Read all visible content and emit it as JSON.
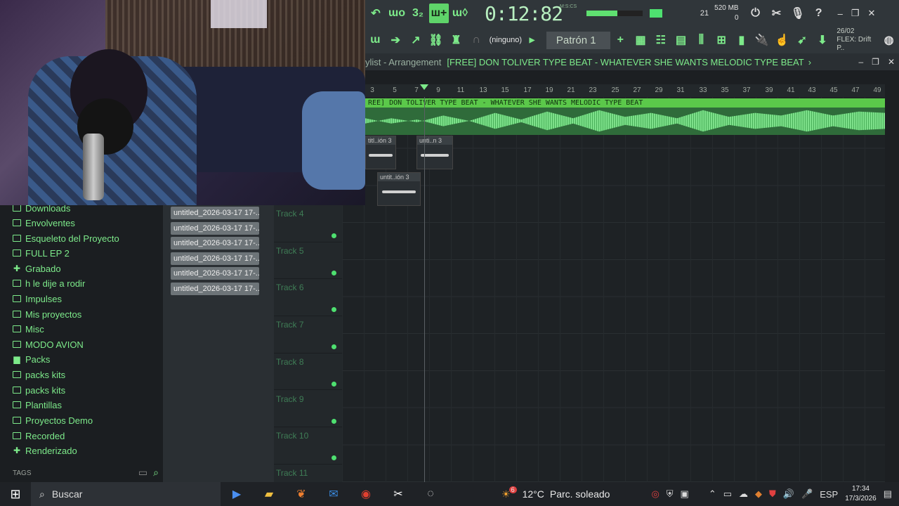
{
  "toolbar": {
    "time": "0:12:82",
    "time_unit": "M:S:CS",
    "cpu_value": "21",
    "mem_value": "520 MB",
    "mem_sub": "0",
    "preset": "(ninguno)",
    "pattern": "Patrón 1",
    "date_short": "26/02",
    "flex_label": "FLEX: Drift P..",
    "win_min": "–",
    "win_max": "❐",
    "win_close": "✕",
    "help": "?"
  },
  "playlist": {
    "crumb": "ylist - Arrangement",
    "title": "[FREE] DON TOLIVER TYPE BEAT - WHATEVER SHE WANTS  MELODIC TYPE BEAT",
    "title_arrow": "›",
    "clip_label": "REE] DON TOLIVER TYPE BEAT - WHATEVER SHE WANTS  MELODIC TYPE BEAT",
    "small_clips": [
      "titl..ión 3",
      "unti..n 3",
      "untit..ión 3"
    ],
    "ruler": [
      "3",
      "5",
      "7",
      "9",
      "11",
      "13",
      "15",
      "17",
      "19",
      "21",
      "23",
      "25",
      "27",
      "29",
      "31",
      "33",
      "35",
      "37",
      "39",
      "41",
      "43",
      "45",
      "47",
      "49"
    ],
    "tracks": [
      "Track 4",
      "Track 5",
      "Track 6",
      "Track 7",
      "Track 8",
      "Track 9",
      "Track 10",
      "Track 11"
    ]
  },
  "browser": {
    "items": [
      {
        "label": "Downloads",
        "icon": "folder-icon"
      },
      {
        "label": "Envolventes",
        "icon": "folder-icon"
      },
      {
        "label": "Esqueleto del Proyecto",
        "icon": "folder-icon"
      },
      {
        "label": "FULL EP 2",
        "icon": "folder-icon"
      },
      {
        "label": "Grabado",
        "icon": "recorded-icon"
      },
      {
        "label": "h le dije a rodir",
        "icon": "folder-icon"
      },
      {
        "label": "Impulses",
        "icon": "folder-icon"
      },
      {
        "label": "Mis proyectos",
        "icon": "folder-icon"
      },
      {
        "label": "Misc",
        "icon": "folder-icon"
      },
      {
        "label": "MODO AVION",
        "icon": "folder-icon"
      },
      {
        "label": "Packs",
        "icon": "packs-icon"
      },
      {
        "label": "packs kits",
        "icon": "folder-icon"
      },
      {
        "label": "packs kits",
        "icon": "folder-icon"
      },
      {
        "label": "Plantillas",
        "icon": "folder-icon"
      },
      {
        "label": "Proyectos Demo",
        "icon": "folder-icon"
      },
      {
        "label": "Recorded",
        "icon": "folder-icon"
      },
      {
        "label": "Renderizado",
        "icon": "render-icon"
      }
    ],
    "footer": "TAGS"
  },
  "patterns": [
    "untitled_2026-03-17 17-..",
    "untitled_2026-03-17 17-..",
    "untitled_2026-03-17 17-..",
    "untitled_2026-03-17 17-..",
    "untitled_2026-03-17 17-..",
    "untitled_2026-03-17 17-.."
  ],
  "taskbar": {
    "search_placeholder": "Buscar",
    "temp": "12°C",
    "weather": "Parc. soleado",
    "lang": "ESP",
    "time": "17:34",
    "date": "17/3/2026",
    "weather_badge": "6"
  },
  "colors": {
    "accent": "#7dea8a",
    "wave": "#5bc84a",
    "bg": "#1e2225"
  }
}
